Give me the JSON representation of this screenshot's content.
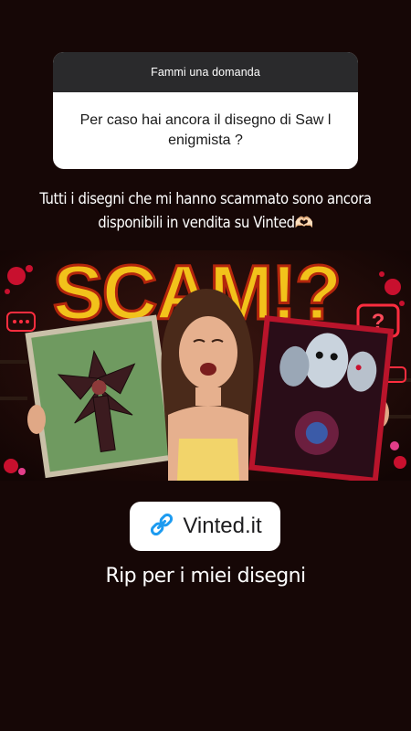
{
  "question_sticker": {
    "header": "Fammi una domanda",
    "question": "Per caso hai ancora il disegno di Saw l enigmista ?"
  },
  "answer_text": "Tutti i disegni che mi hanno scammato sono ancora disponibili in vendita su Vinted🫶🏻",
  "thumbnail": {
    "title": "SCAM!?",
    "accent_color": "#f2c21b"
  },
  "link_sticker": {
    "label": "Vinted.it",
    "icon": "link-icon",
    "icon_color": "#1d9bf0"
  },
  "caption": "Rip per i miei disegni"
}
